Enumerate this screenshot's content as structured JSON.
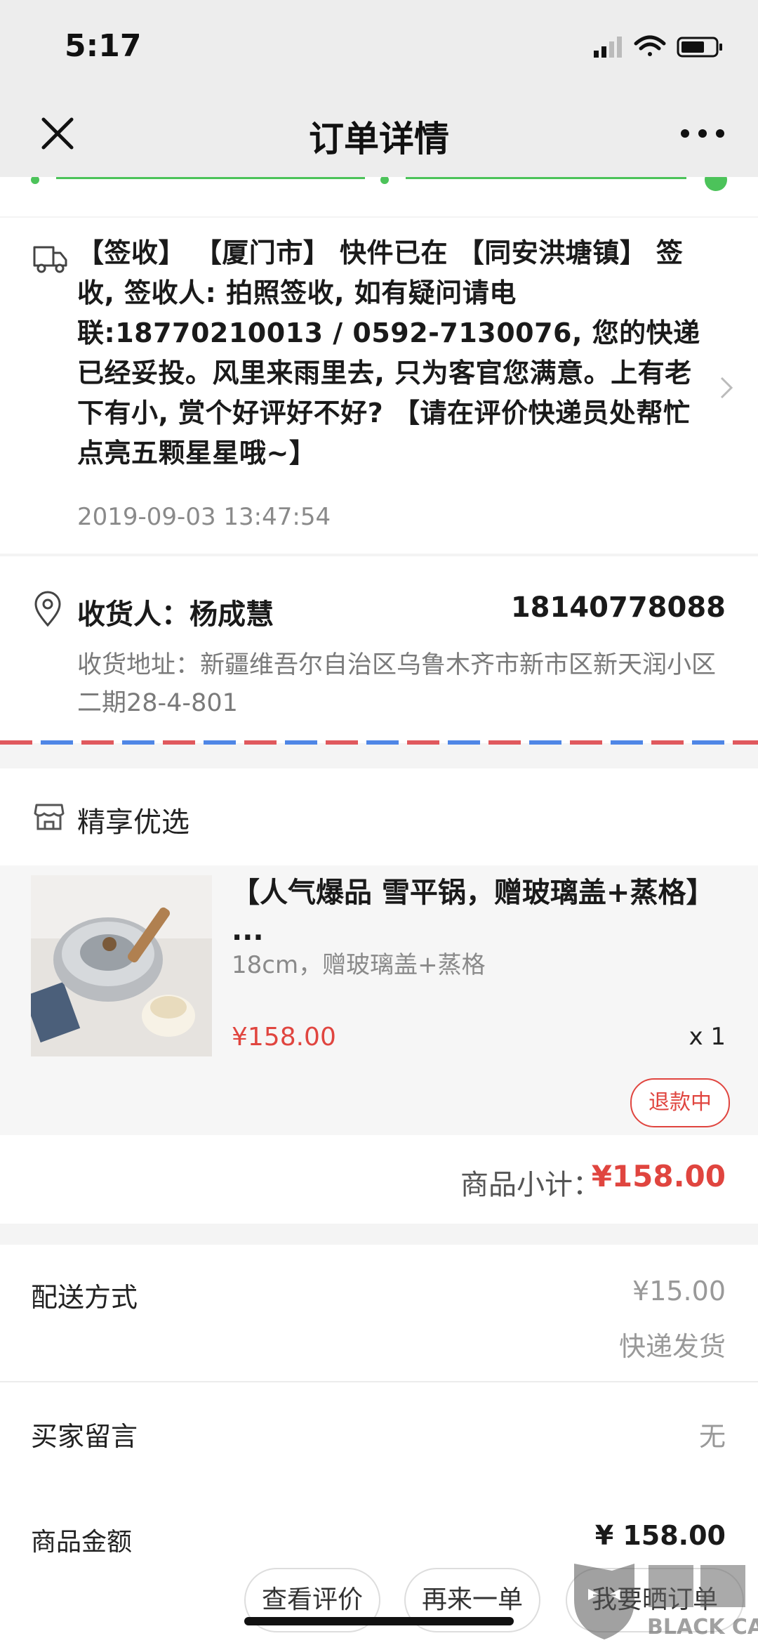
{
  "status_bar": {
    "time": "5:17"
  },
  "nav": {
    "title": "订单详情"
  },
  "logistics": {
    "text": "【签收】 【厦门市】 快件已在 【同安洪塘镇】 签收, 签收人: 拍照签收, 如有疑问请电联:18770210013 / 0592-7130076, 您的快递已经妥投。风里来雨里去, 只为客官您满意。上有老下有小, 赏个好评好不好? 【请在评价快递员处帮忙点亮五颗星星哦~】",
    "time": "2019-09-03 13:47:54"
  },
  "consignee": {
    "name": "收货人：杨成慧",
    "phone": "18140778088",
    "address": "收货地址：新疆维吾尔自治区乌鲁木齐市新市区新天润小区二期28-4-801"
  },
  "shop": {
    "name": "精享优选"
  },
  "item": {
    "title": "【人气爆品 雪平锅，赠玻璃盖+蒸格】 ...",
    "spec": "18cm，赠玻璃盖+蒸格",
    "price": "¥158.00",
    "qty": "x 1",
    "status": "退款中"
  },
  "subtotal": {
    "label": "商品小计：",
    "value": "¥158.00"
  },
  "delivery": {
    "label": "配送方式",
    "fee": "¥15.00",
    "method": "快递发货"
  },
  "message": {
    "label": "买家留言",
    "value": "无"
  },
  "amount": {
    "label": "商品金额",
    "value": "¥ 158.00"
  },
  "actions": {
    "view_review": "查看评价",
    "reorder": "再来一单",
    "share_order": "我要晒订单"
  },
  "watermark": {
    "text": "BLACK CAT"
  },
  "colors": {
    "accent_red": "#e0453f",
    "progress_green": "#4cc35a",
    "envelope_blue": "#4f86e6",
    "envelope_red": "#e0595d"
  }
}
